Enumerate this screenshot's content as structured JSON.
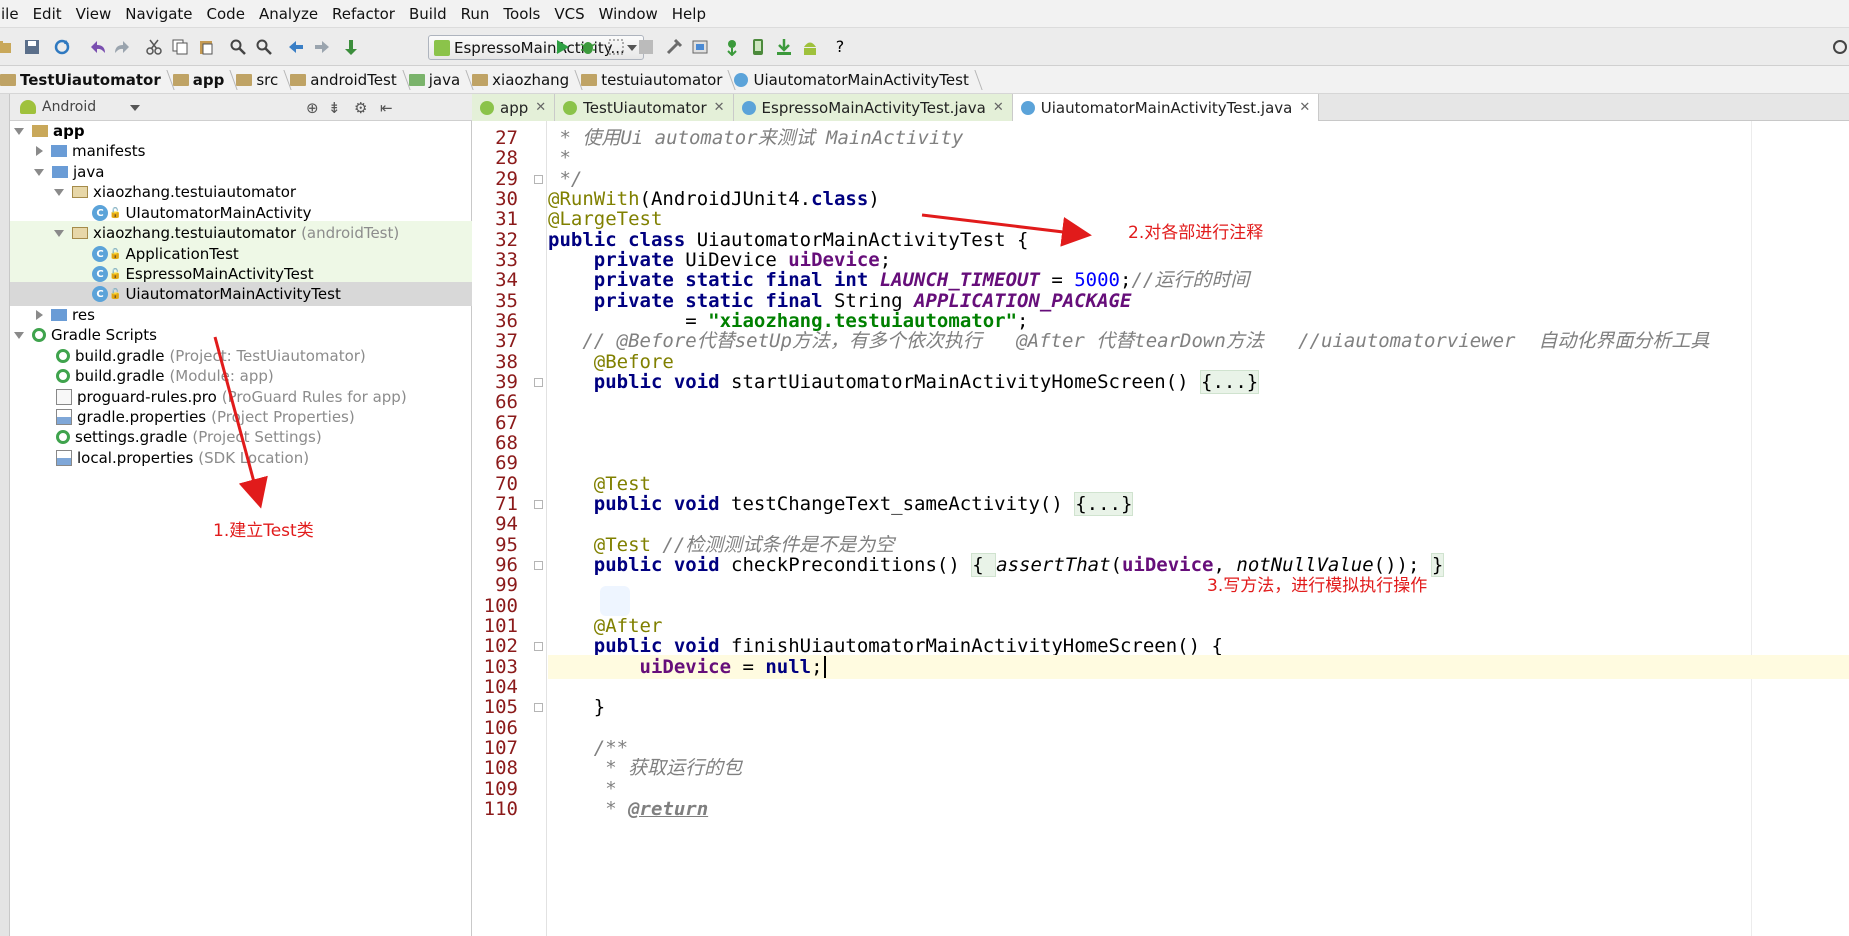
{
  "menu": [
    "ile",
    "Edit",
    "View",
    "Navigate",
    "Code",
    "Analyze",
    "Refactor",
    "Build",
    "Run",
    "Tools",
    "VCS",
    "Window",
    "Help"
  ],
  "toolbar": {
    "run_config": "EspressoMainActivity...",
    "help": "?"
  },
  "breadcrumb": [
    "TestUiautomator",
    "app",
    "src",
    "androidTest",
    "java",
    "xiaozhang",
    "testuiautomator",
    "UiautomatorMainActivityTest"
  ],
  "project_panel": {
    "view_mode": "Android"
  },
  "tree": [
    {
      "label": "app",
      "note": "",
      "level": 0,
      "state": "open",
      "icon": "module-folder-icon"
    },
    {
      "label": "manifests",
      "note": "",
      "level": 1,
      "state": "closed",
      "icon": "folder-icon"
    },
    {
      "label": "java",
      "note": "",
      "level": 1,
      "state": "open",
      "icon": "folder-icon"
    },
    {
      "label": "xiaozhang.testuiautomator",
      "note": "",
      "level": 2,
      "state": "open",
      "icon": "package-icon"
    },
    {
      "label": "UIautomatorMainActivity",
      "note": "",
      "level": 3,
      "state": "leaf",
      "icon": "class-icon"
    },
    {
      "label": "xiaozhang.testuiautomator",
      "note": "(androidTest)",
      "level": 2,
      "state": "open",
      "icon": "package-icon",
      "highlight": "green"
    },
    {
      "label": "ApplicationTest",
      "note": "",
      "level": 3,
      "state": "leaf",
      "icon": "test-class-icon",
      "highlight": "green"
    },
    {
      "label": "EspressoMainActivityTest",
      "note": "",
      "level": 3,
      "state": "leaf",
      "icon": "test-class-icon",
      "highlight": "green"
    },
    {
      "label": "UiautomatorMainActivityTest",
      "note": "",
      "level": 3,
      "state": "leaf",
      "icon": "test-class-icon",
      "highlight": "selected"
    },
    {
      "label": "res",
      "note": "",
      "level": 1,
      "state": "closed",
      "icon": "folder-icon"
    },
    {
      "label": "Gradle Scripts",
      "note": "",
      "level": 0,
      "state": "open",
      "icon": "gradle-icon"
    },
    {
      "label": "build.gradle",
      "note": "(Project: TestUiautomator)",
      "level": 1,
      "state": "leaf",
      "icon": "gradle-icon"
    },
    {
      "label": "build.gradle",
      "note": "(Module: app)",
      "level": 1,
      "state": "leaf",
      "icon": "gradle-icon"
    },
    {
      "label": "proguard-rules.pro",
      "note": "(ProGuard Rules for app)",
      "level": 1,
      "state": "leaf",
      "icon": "file-icon"
    },
    {
      "label": "gradle.properties",
      "note": "(Project Properties)",
      "level": 1,
      "state": "leaf",
      "icon": "properties-icon"
    },
    {
      "label": "settings.gradle",
      "note": "(Project Settings)",
      "level": 1,
      "state": "leaf",
      "icon": "gradle-icon"
    },
    {
      "label": "local.properties",
      "note": "(SDK Location)",
      "level": 1,
      "state": "leaf",
      "icon": "properties-icon"
    }
  ],
  "editor_tabs": [
    {
      "label": "app",
      "style": "green"
    },
    {
      "label": "TestUiautomator",
      "style": "green"
    },
    {
      "label": "EspressoMainActivityTest.java",
      "style": "green"
    },
    {
      "label": "UiautomatorMainActivityTest.java",
      "style": "active"
    }
  ],
  "line_numbers": [
    "27",
    "28",
    "29",
    "30",
    "31",
    "32",
    "33",
    "34",
    "35",
    "36",
    "37",
    "38",
    "39",
    "66",
    "67",
    "68",
    "69",
    "70",
    "71",
    "94",
    "95",
    "96",
    "99",
    "100",
    "101",
    "102",
    "103",
    "104",
    "105",
    "106",
    "107",
    "108",
    "109",
    "110"
  ],
  "code": {
    "l27a": " * ",
    "l27b": "使用Ui automator来测试 MainActivity",
    "l28": " *",
    "l29": " */",
    "l30a": "@RunWith",
    "l30b": "(AndroidJUnit4.",
    "l30c": "class",
    "l30d": ")",
    "l31": "@LargeTest",
    "l32a": "public class ",
    "l32b": "UiautomatorMainActivityTest {",
    "l33a": "    private ",
    "l33b": "UiDevice ",
    "l33c": "uiDevice",
    "l33d": ";",
    "l34a": "    private static final int ",
    "l34b": "LAUNCH_TIMEOUT",
    "l34c": " = ",
    "l34d": "5000",
    "l34e": ";",
    "l34f": "//运行的时间",
    "l35a": "    private static final ",
    "l35b": "String ",
    "l35c": "APPLICATION_PACKAGE",
    "l36a": "            = ",
    "l36b": "\"xiaozhang.testuiautomator\"",
    "l36c": ";",
    "l37": "   // @Before代替setUp方法，有多个依次执行   @After 代替tearDown方法   //uiautomatorviewer  自动化界面分析工具",
    "l38": "    @Before",
    "l39a": "    public void ",
    "l39b": "startUiautomatorMainActivityHomeScreen() ",
    "l39c": "{...}",
    "l70": "    @Test",
    "l71a": "    public void ",
    "l71b": "testChangeText_sameActivity() ",
    "l71c": "{...}",
    "l95a": "    @Test ",
    "l95b": "//检测测试条件是不是为空",
    "l96a": "    public void ",
    "l96b": "checkPreconditions() ",
    "l96c": "{ ",
    "l96d": "assertThat",
    "l96e": "(",
    "l96f": "uiDevice",
    "l96g": ", ",
    "l96h": "notNullValue",
    "l96i": "()); ",
    "l96j": "}",
    "l101": "    @After",
    "l102a": "    public void ",
    "l102b": "finishUiautomatorMainActivityHomeScreen() {",
    "l103a": "        ",
    "l103b": "uiDevice",
    "l103c": " = ",
    "l103d": "null",
    "l103e": ";",
    "l105": "    }",
    "l107": "    /**",
    "l108a": "     * ",
    "l108b": "获取运行的包",
    "l109": "     *",
    "l110a": "     * ",
    "l110b": "@return"
  },
  "annotations": {
    "note1": "1.建立Test类",
    "note2": "2.对各部进行注释",
    "note3": "3.写方法，进行模拟执行操作",
    "color": "#e11b1b"
  }
}
